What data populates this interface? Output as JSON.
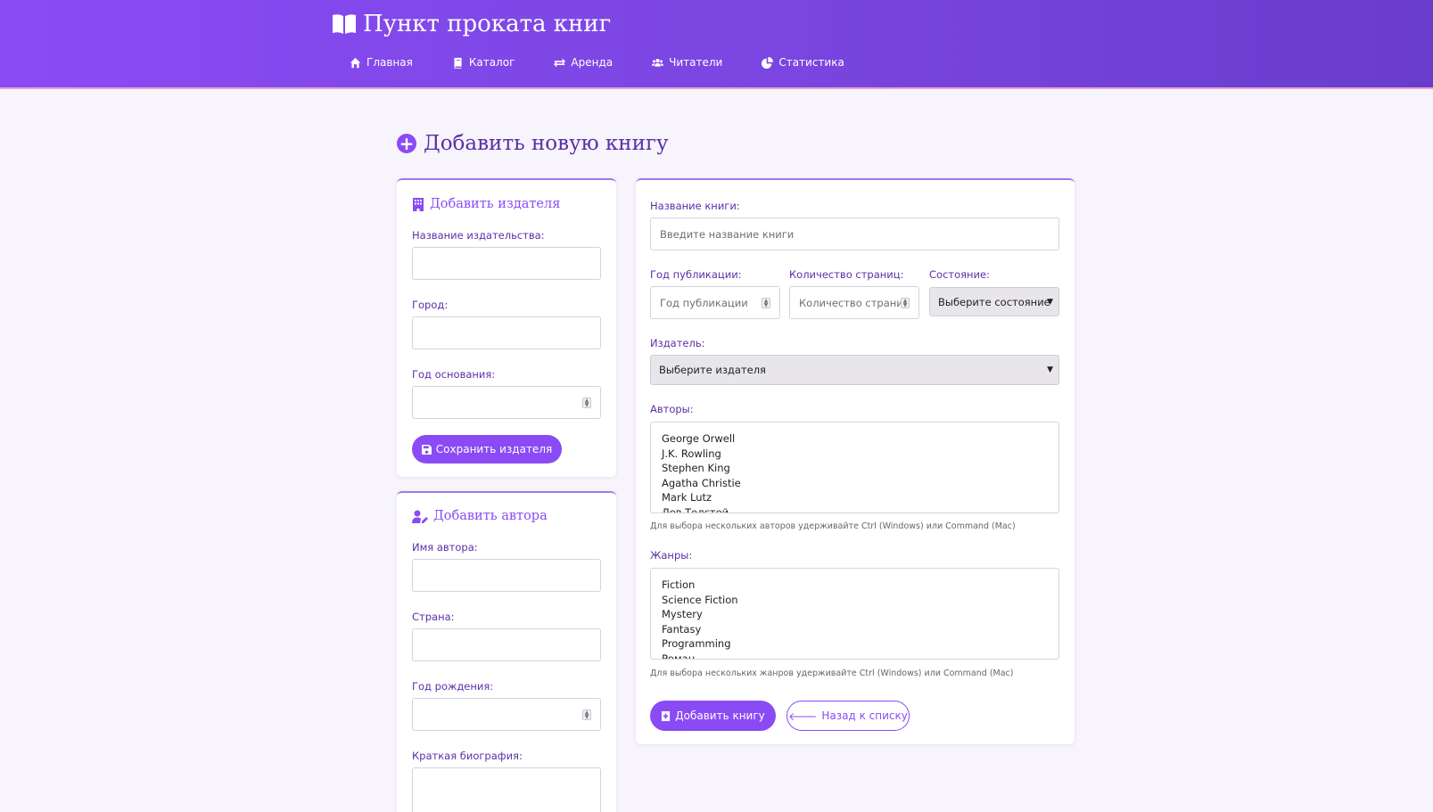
{
  "app": {
    "title": "Пункт проката книг"
  },
  "nav": {
    "home": "Главная",
    "catalog": "Каталог",
    "rent": "Аренда",
    "readers": "Читатели",
    "stats": "Статистика"
  },
  "page": {
    "title": "Добавить новую книгу"
  },
  "publisher_form": {
    "title": "Добавить издателя",
    "name_label": "Название издательства:",
    "name_value": "",
    "city_label": "Город:",
    "city_value": "",
    "founded_label": "Год основания:",
    "founded_value": "",
    "save_button": "Сохранить издателя"
  },
  "author_form": {
    "title": "Добавить автора",
    "name_label": "Имя автора:",
    "name_value": "",
    "country_label": "Страна:",
    "country_value": "",
    "birth_label": "Год рождения:",
    "birth_value": "",
    "bio_label": "Краткая биография:",
    "bio_value": ""
  },
  "book_form": {
    "title_label": "Название книги:",
    "title_placeholder": "Введите название книги",
    "year_label": "Год публикации:",
    "year_placeholder": "Год публикации",
    "pages_label": "Количество страниц:",
    "pages_placeholder": "Количество страниц",
    "condition_label": "Состояние:",
    "condition_selected": "Выберите состояние",
    "publisher_label": "Издатель:",
    "publisher_selected": "Выберите издателя",
    "authors_label": "Авторы:",
    "authors": [
      "George Orwell",
      "J.K. Rowling",
      "Stephen King",
      "Agatha Christie",
      "Mark Lutz",
      "Лев Толстой"
    ],
    "authors_hint": "Для выбора нескольких авторов удерживайте Ctrl (Windows) или Command (Mac)",
    "genres_label": "Жанры:",
    "genres": [
      "Fiction",
      "Science Fiction",
      "Mystery",
      "Fantasy",
      "Programming",
      "Роман"
    ],
    "genres_hint": "Для выбора нескольких жанров удерживайте Ctrl (Windows) или Command (Mac)",
    "submit_button": "Добавить книгу",
    "back_button": "Назад к списку",
    "back_arrow": "🡐"
  },
  "colors": {
    "accent": "#8a4bf5",
    "header_start": "#8a4bf5",
    "header_end": "#6a3ccc",
    "heading": "#5b2fa8"
  }
}
